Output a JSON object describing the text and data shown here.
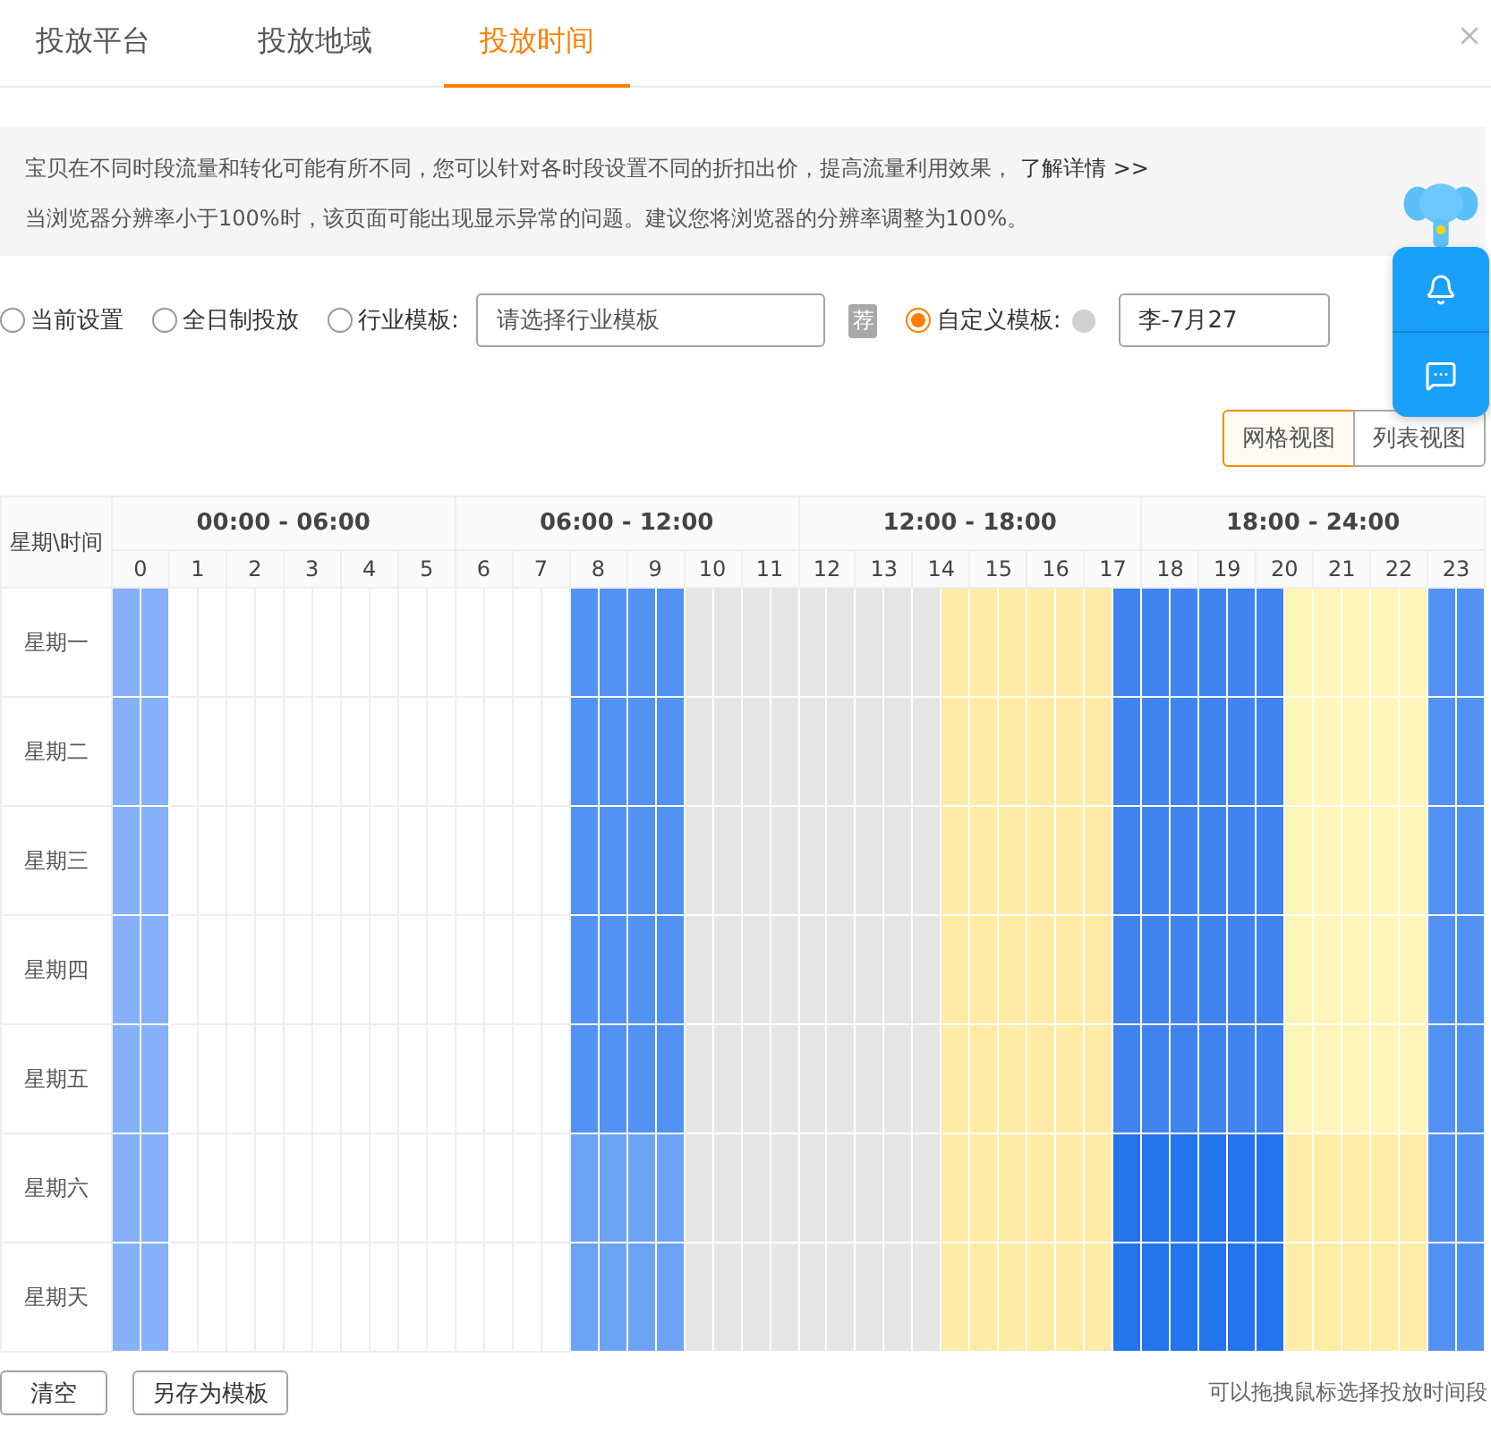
{
  "tabs": [
    {
      "label": "投放平台",
      "selected": false
    },
    {
      "label": "投放地域",
      "selected": false
    },
    {
      "label": "投放时间",
      "selected": true
    }
  ],
  "notice": {
    "lines": [
      {
        "text": "宝贝在不同时段流量和转化可能有所不同，您可以针对各时段设置不同的折扣出价，提高流量利用效果，",
        "link": "了解详情 >>"
      },
      {
        "text": "当浏览器分辨率小于100%时，该页面可能出现显示异常的问题。建议您将浏览器的分辨率调整为100%。"
      }
    ]
  },
  "templates": [
    {
      "kind": "plain",
      "label": "当前设置",
      "selected": false
    },
    {
      "kind": "plain",
      "label": "全日制投放",
      "selected": false
    },
    {
      "kind": "industry",
      "label": "行业模板:",
      "selected": false,
      "placeholder": "请选择行业模板",
      "tag": "荐"
    },
    {
      "kind": "custom",
      "label": "自定义模板:",
      "selected": true,
      "value": "李-7月27"
    }
  ],
  "views": [
    {
      "label": "网格视图",
      "selected": true
    },
    {
      "label": "列表视图",
      "selected": false
    }
  ],
  "grid": {
    "corner": "星期\\时间",
    "ranges": [
      "00:00 - 06:00",
      "06:00 - 12:00",
      "12:00 - 18:00",
      "18:00 - 24:00"
    ],
    "hours": [
      "0",
      "1",
      "2",
      "3",
      "4",
      "5",
      "6",
      "7",
      "8",
      "9",
      "10",
      "11",
      "12",
      "13",
      "14",
      "15",
      "16",
      "17",
      "18",
      "19",
      "20",
      "21",
      "22",
      "23"
    ],
    "rows": [
      {
        "day": "星期一",
        "cells": [
          {
            "color": "#86b0f8"
          },
          {
            "color": "#86b0f8"
          },
          {
            "color": "#ffffff"
          },
          {
            "color": "#ffffff"
          },
          {
            "color": "#ffffff"
          },
          {
            "color": "#ffffff"
          },
          {
            "color": "#ffffff"
          },
          {
            "color": "#ffffff"
          },
          {
            "color": "#ffffff"
          },
          {
            "color": "#ffffff"
          },
          {
            "color": "#ffffff"
          },
          {
            "color": "#ffffff"
          },
          {
            "color": "#ffffff"
          },
          {
            "color": "#ffffff"
          },
          {
            "color": "#ffffff"
          },
          {
            "color": "#ffffff"
          },
          {
            "color": "#5292f3"
          },
          {
            "color": "#5292f3"
          },
          {
            "color": "#5292f3"
          },
          {
            "color": "#5292f3"
          },
          {
            "color": "#e5e5e5"
          },
          {
            "color": "#e5e5e5"
          },
          {
            "color": "#e5e5e5"
          },
          {
            "color": "#e5e5e5"
          },
          {
            "color": "#e5e5e5"
          },
          {
            "color": "#e5e5e5"
          },
          {
            "color": "#e5e5e5"
          },
          {
            "color": "#e5e5e5"
          },
          {
            "color": "#e5e5e5"
          },
          {
            "color": "#ffeba6"
          },
          {
            "color": "#ffeba6"
          },
          {
            "color": "#ffeba6"
          },
          {
            "color": "#ffeba6"
          },
          {
            "color": "#ffeba6"
          },
          {
            "color": "#ffeba6"
          },
          {
            "color": "#4184ef"
          },
          {
            "color": "#4184ef"
          },
          {
            "color": "#4184ef"
          },
          {
            "color": "#4184ef"
          },
          {
            "color": "#4184ef"
          },
          {
            "color": "#4184ef"
          },
          {
            "color": "#fff5b9"
          },
          {
            "color": "#fff5b9"
          },
          {
            "color": "#fff5b9"
          },
          {
            "color": "#fff5b9"
          },
          {
            "color": "#fff5b9"
          },
          {
            "color": "#5292f3"
          },
          {
            "color": "#5292f3"
          }
        ]
      },
      {
        "day": "星期二",
        "cells": [
          {
            "color": "#86b0f8"
          },
          {
            "color": "#86b0f8"
          },
          {
            "color": "#ffffff"
          },
          {
            "color": "#ffffff"
          },
          {
            "color": "#ffffff"
          },
          {
            "color": "#ffffff"
          },
          {
            "color": "#ffffff"
          },
          {
            "color": "#ffffff"
          },
          {
            "color": "#ffffff"
          },
          {
            "color": "#ffffff"
          },
          {
            "color": "#ffffff"
          },
          {
            "color": "#ffffff"
          },
          {
            "color": "#ffffff"
          },
          {
            "color": "#ffffff"
          },
          {
            "color": "#ffffff"
          },
          {
            "color": "#ffffff"
          },
          {
            "color": "#5292f3"
          },
          {
            "color": "#5292f3"
          },
          {
            "color": "#5292f3"
          },
          {
            "color": "#5292f3"
          },
          {
            "color": "#e5e5e5"
          },
          {
            "color": "#e5e5e5"
          },
          {
            "color": "#e5e5e5"
          },
          {
            "color": "#e5e5e5"
          },
          {
            "color": "#e5e5e5"
          },
          {
            "color": "#e5e5e5"
          },
          {
            "color": "#e5e5e5"
          },
          {
            "color": "#e5e5e5"
          },
          {
            "color": "#e5e5e5"
          },
          {
            "color": "#ffeba6"
          },
          {
            "color": "#ffeba6"
          },
          {
            "color": "#ffeba6"
          },
          {
            "color": "#ffeba6"
          },
          {
            "color": "#ffeba6"
          },
          {
            "color": "#ffeba6"
          },
          {
            "color": "#4184ef"
          },
          {
            "color": "#4184ef"
          },
          {
            "color": "#4184ef"
          },
          {
            "color": "#4184ef"
          },
          {
            "color": "#4184ef"
          },
          {
            "color": "#4184ef"
          },
          {
            "color": "#fff5b9"
          },
          {
            "color": "#fff5b9"
          },
          {
            "color": "#fff5b9"
          },
          {
            "color": "#fff5b9"
          },
          {
            "color": "#fff5b9"
          },
          {
            "color": "#5292f3"
          },
          {
            "color": "#5292f3"
          }
        ]
      },
      {
        "day": "星期三",
        "cells": [
          {
            "color": "#86b0f8"
          },
          {
            "color": "#86b0f8"
          },
          {
            "color": "#ffffff"
          },
          {
            "color": "#ffffff"
          },
          {
            "color": "#ffffff"
          },
          {
            "color": "#ffffff"
          },
          {
            "color": "#ffffff"
          },
          {
            "color": "#ffffff"
          },
          {
            "color": "#ffffff"
          },
          {
            "color": "#ffffff"
          },
          {
            "color": "#ffffff"
          },
          {
            "color": "#ffffff"
          },
          {
            "color": "#ffffff"
          },
          {
            "color": "#ffffff"
          },
          {
            "color": "#ffffff"
          },
          {
            "color": "#ffffff"
          },
          {
            "color": "#5292f3"
          },
          {
            "color": "#5292f3"
          },
          {
            "color": "#5292f3"
          },
          {
            "color": "#5292f3"
          },
          {
            "color": "#e5e5e5"
          },
          {
            "color": "#e5e5e5"
          },
          {
            "color": "#e5e5e5"
          },
          {
            "color": "#e5e5e5"
          },
          {
            "color": "#e5e5e5"
          },
          {
            "color": "#e5e5e5"
          },
          {
            "color": "#e5e5e5"
          },
          {
            "color": "#e5e5e5"
          },
          {
            "color": "#e5e5e5"
          },
          {
            "color": "#ffeba6"
          },
          {
            "color": "#ffeba6"
          },
          {
            "color": "#ffeba6"
          },
          {
            "color": "#ffeba6"
          },
          {
            "color": "#ffeba6"
          },
          {
            "color": "#ffeba6"
          },
          {
            "color": "#4184ef"
          },
          {
            "color": "#4184ef"
          },
          {
            "color": "#4184ef"
          },
          {
            "color": "#4184ef"
          },
          {
            "color": "#4184ef"
          },
          {
            "color": "#4184ef"
          },
          {
            "color": "#fff5b9"
          },
          {
            "color": "#fff5b9"
          },
          {
            "color": "#fff5b9"
          },
          {
            "color": "#fff5b9"
          },
          {
            "color": "#fff5b9"
          },
          {
            "color": "#5292f3"
          },
          {
            "color": "#5292f3"
          }
        ]
      },
      {
        "day": "星期四",
        "cells": [
          {
            "color": "#86b0f8"
          },
          {
            "color": "#86b0f8"
          },
          {
            "color": "#ffffff"
          },
          {
            "color": "#ffffff"
          },
          {
            "color": "#ffffff"
          },
          {
            "color": "#ffffff"
          },
          {
            "color": "#ffffff"
          },
          {
            "color": "#ffffff"
          },
          {
            "color": "#ffffff"
          },
          {
            "color": "#ffffff"
          },
          {
            "color": "#ffffff"
          },
          {
            "color": "#ffffff"
          },
          {
            "color": "#ffffff"
          },
          {
            "color": "#ffffff"
          },
          {
            "color": "#ffffff"
          },
          {
            "color": "#ffffff"
          },
          {
            "color": "#5292f3"
          },
          {
            "color": "#5292f3"
          },
          {
            "color": "#5292f3"
          },
          {
            "color": "#5292f3"
          },
          {
            "color": "#e5e5e5"
          },
          {
            "color": "#e5e5e5"
          },
          {
            "color": "#e5e5e5"
          },
          {
            "color": "#e5e5e5"
          },
          {
            "color": "#e5e5e5"
          },
          {
            "color": "#e5e5e5"
          },
          {
            "color": "#e5e5e5"
          },
          {
            "color": "#e5e5e5"
          },
          {
            "color": "#e5e5e5"
          },
          {
            "color": "#ffeba6"
          },
          {
            "color": "#ffeba6"
          },
          {
            "color": "#ffeba6"
          },
          {
            "color": "#ffeba6"
          },
          {
            "color": "#ffeba6"
          },
          {
            "color": "#ffeba6"
          },
          {
            "color": "#4184ef"
          },
          {
            "color": "#4184ef"
          },
          {
            "color": "#4184ef"
          },
          {
            "color": "#4184ef"
          },
          {
            "color": "#4184ef"
          },
          {
            "color": "#4184ef"
          },
          {
            "color": "#fff5b9"
          },
          {
            "color": "#fff5b9"
          },
          {
            "color": "#fff5b9"
          },
          {
            "color": "#fff5b9"
          },
          {
            "color": "#fff5b9"
          },
          {
            "color": "#5292f3"
          },
          {
            "color": "#5292f3"
          }
        ]
      },
      {
        "day": "星期五",
        "cells": [
          {
            "color": "#86b0f8"
          },
          {
            "color": "#86b0f8"
          },
          {
            "color": "#ffffff"
          },
          {
            "color": "#ffffff"
          },
          {
            "color": "#ffffff"
          },
          {
            "color": "#ffffff"
          },
          {
            "color": "#ffffff"
          },
          {
            "color": "#ffffff"
          },
          {
            "color": "#ffffff"
          },
          {
            "color": "#ffffff"
          },
          {
            "color": "#ffffff"
          },
          {
            "color": "#ffffff"
          },
          {
            "color": "#ffffff"
          },
          {
            "color": "#ffffff"
          },
          {
            "color": "#ffffff"
          },
          {
            "color": "#ffffff"
          },
          {
            "color": "#5292f3"
          },
          {
            "color": "#5292f3"
          },
          {
            "color": "#5292f3"
          },
          {
            "color": "#5292f3"
          },
          {
            "color": "#e5e5e5"
          },
          {
            "color": "#e5e5e5"
          },
          {
            "color": "#e5e5e5"
          },
          {
            "color": "#e5e5e5"
          },
          {
            "color": "#e5e5e5"
          },
          {
            "color": "#e5e5e5"
          },
          {
            "color": "#e5e5e5"
          },
          {
            "color": "#e5e5e5"
          },
          {
            "color": "#e5e5e5"
          },
          {
            "color": "#ffeba6"
          },
          {
            "color": "#ffeba6"
          },
          {
            "color": "#ffeba6"
          },
          {
            "color": "#ffeba6"
          },
          {
            "color": "#ffeba6"
          },
          {
            "color": "#ffeba6"
          },
          {
            "color": "#4184ef"
          },
          {
            "color": "#4184ef"
          },
          {
            "color": "#4184ef"
          },
          {
            "color": "#4184ef"
          },
          {
            "color": "#4184ef"
          },
          {
            "color": "#4184ef"
          },
          {
            "color": "#fff5b9"
          },
          {
            "color": "#fff5b9"
          },
          {
            "color": "#fff5b9"
          },
          {
            "color": "#fff5b9"
          },
          {
            "color": "#fff5b9"
          },
          {
            "color": "#5292f3"
          },
          {
            "color": "#5292f3"
          }
        ]
      },
      {
        "day": "星期六",
        "cells": [
          {
            "color": "#86b0f8"
          },
          {
            "color": "#86b0f8"
          },
          {
            "color": "#ffffff"
          },
          {
            "color": "#ffffff"
          },
          {
            "color": "#ffffff"
          },
          {
            "color": "#ffffff"
          },
          {
            "color": "#ffffff"
          },
          {
            "color": "#ffffff"
          },
          {
            "color": "#ffffff"
          },
          {
            "color": "#ffffff"
          },
          {
            "color": "#ffffff"
          },
          {
            "color": "#ffffff"
          },
          {
            "color": "#ffffff"
          },
          {
            "color": "#ffffff"
          },
          {
            "color": "#ffffff"
          },
          {
            "color": "#ffffff"
          },
          {
            "color": "#6ca3f4"
          },
          {
            "color": "#6ca3f4"
          },
          {
            "color": "#6ca3f4"
          },
          {
            "color": "#6ca3f4"
          },
          {
            "color": "#e5e5e5"
          },
          {
            "color": "#e5e5e5"
          },
          {
            "color": "#e5e5e5"
          },
          {
            "color": "#e5e5e5"
          },
          {
            "color": "#e5e5e5"
          },
          {
            "color": "#e5e5e5"
          },
          {
            "color": "#e5e5e5"
          },
          {
            "color": "#e5e5e5"
          },
          {
            "color": "#e5e5e5"
          },
          {
            "color": "#ffeba6"
          },
          {
            "color": "#ffeba6"
          },
          {
            "color": "#ffeba6"
          },
          {
            "color": "#ffeba6"
          },
          {
            "color": "#ffeba6"
          },
          {
            "color": "#ffeba6"
          },
          {
            "color": "#2474ed"
          },
          {
            "color": "#2474ed"
          },
          {
            "color": "#2474ed"
          },
          {
            "color": "#2474ed"
          },
          {
            "color": "#2474ed"
          },
          {
            "color": "#2474ed"
          },
          {
            "color": "#ffeca6"
          },
          {
            "color": "#ffeca6"
          },
          {
            "color": "#ffeca6"
          },
          {
            "color": "#ffeca6"
          },
          {
            "color": "#ffeca6"
          },
          {
            "color": "#5292f3"
          },
          {
            "color": "#5292f3"
          }
        ]
      },
      {
        "day": "星期天",
        "cells": [
          {
            "color": "#86b0f8"
          },
          {
            "color": "#86b0f8"
          },
          {
            "color": "#ffffff"
          },
          {
            "color": "#ffffff"
          },
          {
            "color": "#ffffff"
          },
          {
            "color": "#ffffff"
          },
          {
            "color": "#ffffff"
          },
          {
            "color": "#ffffff"
          },
          {
            "color": "#ffffff"
          },
          {
            "color": "#ffffff"
          },
          {
            "color": "#ffffff"
          },
          {
            "color": "#ffffff"
          },
          {
            "color": "#ffffff"
          },
          {
            "color": "#ffffff"
          },
          {
            "color": "#ffffff"
          },
          {
            "color": "#ffffff"
          },
          {
            "color": "#6ca3f4"
          },
          {
            "color": "#6ca3f4"
          },
          {
            "color": "#6ca3f4"
          },
          {
            "color": "#6ca3f4"
          },
          {
            "color": "#e5e5e5"
          },
          {
            "color": "#e5e5e5"
          },
          {
            "color": "#e5e5e5"
          },
          {
            "color": "#e5e5e5"
          },
          {
            "color": "#e5e5e5"
          },
          {
            "color": "#e5e5e5"
          },
          {
            "color": "#e5e5e5"
          },
          {
            "color": "#e5e5e5"
          },
          {
            "color": "#e5e5e5"
          },
          {
            "color": "#ffeba6"
          },
          {
            "color": "#ffeba6"
          },
          {
            "color": "#ffeba6"
          },
          {
            "color": "#ffeba6"
          },
          {
            "color": "#ffeba6"
          },
          {
            "color": "#ffeba6"
          },
          {
            "color": "#2474ed"
          },
          {
            "color": "#2474ed"
          },
          {
            "color": "#2474ed"
          },
          {
            "color": "#2474ed"
          },
          {
            "color": "#2474ed"
          },
          {
            "color": "#2474ed"
          },
          {
            "color": "#ffeca6"
          },
          {
            "color": "#ffeca6"
          },
          {
            "color": "#ffeca6"
          },
          {
            "color": "#ffeca6"
          },
          {
            "color": "#ffeca6"
          },
          {
            "color": "#5292f3"
          },
          {
            "color": "#5292f3"
          }
        ]
      }
    ]
  },
  "buttons": [
    "清空",
    "另存为模板"
  ],
  "hint": "可以拖拽鼠标选择投放时间段"
}
